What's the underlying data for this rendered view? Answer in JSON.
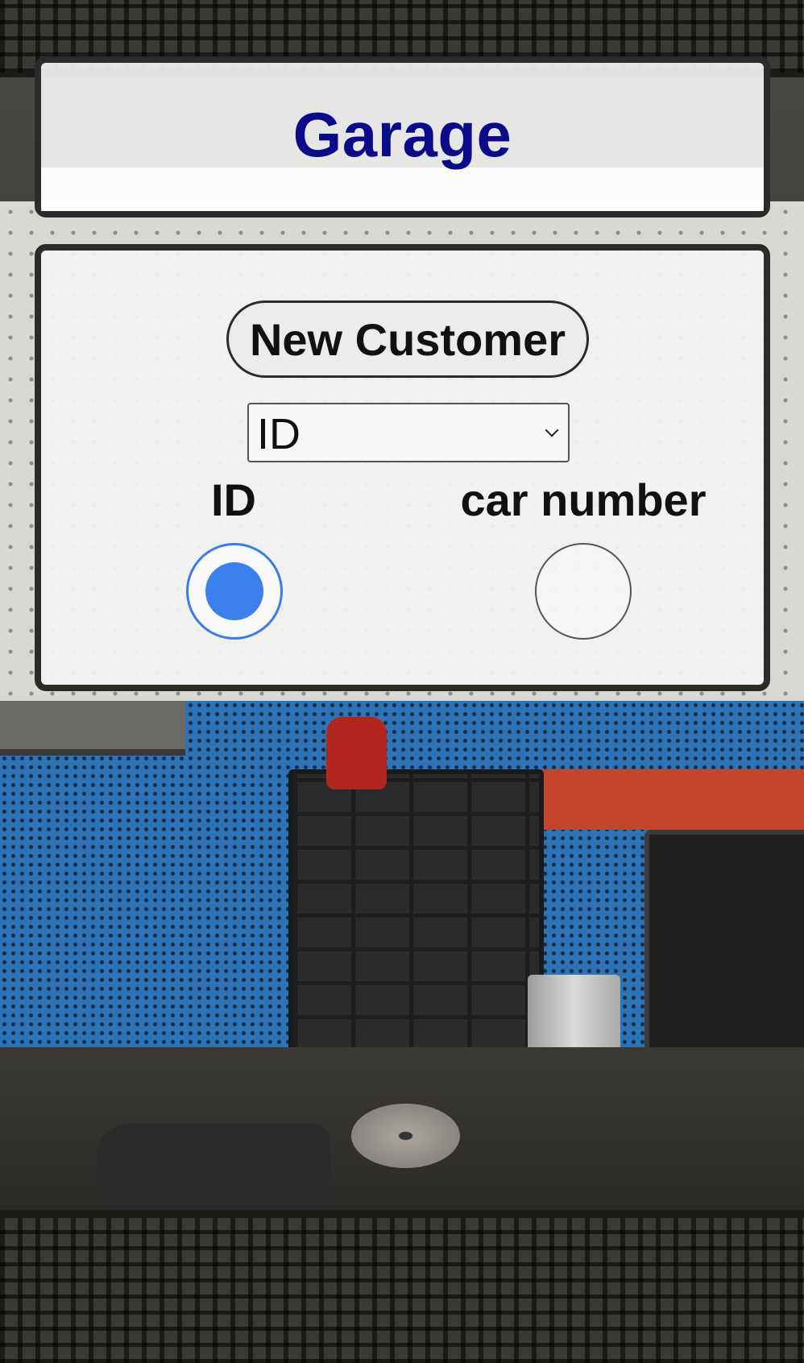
{
  "app": {
    "title": "Garage"
  },
  "form": {
    "new_customer_label": "New Customer",
    "search_by_select": {
      "selected": "ID",
      "options": [
        "ID"
      ]
    },
    "radios": [
      {
        "label": "ID",
        "checked": true
      },
      {
        "label": "car number",
        "checked": false
      }
    ]
  },
  "colors": {
    "title": "#0b0b8a",
    "radio_accent": "#3b80ec",
    "panel_border": "#2b2b2b"
  }
}
